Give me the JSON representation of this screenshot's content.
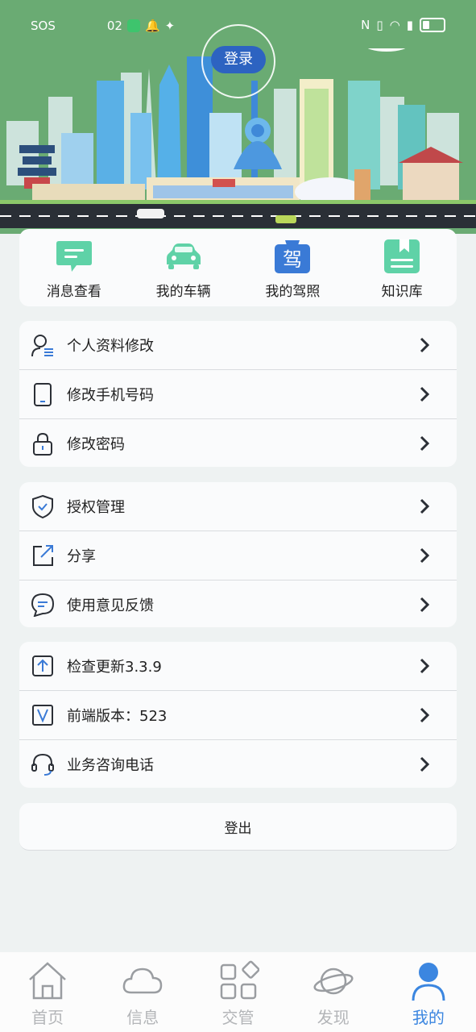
{
  "status_bar": {
    "left_text": "SOS",
    "time": "02",
    "icons": [
      "sos-icon",
      "app-badge-icon",
      "bell-icon",
      "pin-icon",
      "nfc-icon",
      "vibrate-icon",
      "wifi-icon",
      "alert-icon",
      "battery-icon"
    ]
  },
  "header": {
    "login_label": "登录",
    "theme_color": "#6aab73",
    "login_color": "#2d63c1"
  },
  "quick_actions": [
    {
      "label": "消息查看",
      "icon": "message-icon",
      "color": "#5fd2a7"
    },
    {
      "label": "我的车辆",
      "icon": "car-icon",
      "color": "#5fd2a7"
    },
    {
      "label": "我的驾照",
      "icon": "license-icon",
      "color": "#3a7ad6"
    },
    {
      "label": "知识库",
      "icon": "book-icon",
      "color": "#5fd2a7"
    }
  ],
  "menu_group_1": [
    {
      "label": "个人资料修改",
      "icon": "profile-edit-icon"
    },
    {
      "label": "修改手机号码",
      "icon": "phone-icon"
    },
    {
      "label": "修改密码",
      "icon": "lock-icon"
    }
  ],
  "menu_group_2": [
    {
      "label": "授权管理",
      "icon": "shield-icon"
    },
    {
      "label": "分享",
      "icon": "share-icon"
    },
    {
      "label": "使用意见反馈",
      "icon": "feedback-icon"
    }
  ],
  "menu_group_3": [
    {
      "label": "检查更新3.3.9",
      "icon": "update-icon"
    },
    {
      "label": "前端版本：523",
      "icon": "version-icon"
    },
    {
      "label": "业务咨询电话",
      "icon": "headset-icon"
    }
  ],
  "logout_label": "登出",
  "tabs": [
    {
      "label": "首页",
      "icon": "home-icon",
      "active": false
    },
    {
      "label": "信息",
      "icon": "cloud-icon",
      "active": false
    },
    {
      "label": "交管",
      "icon": "grid-icon",
      "active": false
    },
    {
      "label": "发现",
      "icon": "planet-icon",
      "active": false
    },
    {
      "label": "我的",
      "icon": "user-icon",
      "active": true
    }
  ],
  "colors": {
    "accent": "#3b86e0",
    "tab_inactive": "#b3b5b8",
    "icon_blue": "#3a7ad6"
  }
}
